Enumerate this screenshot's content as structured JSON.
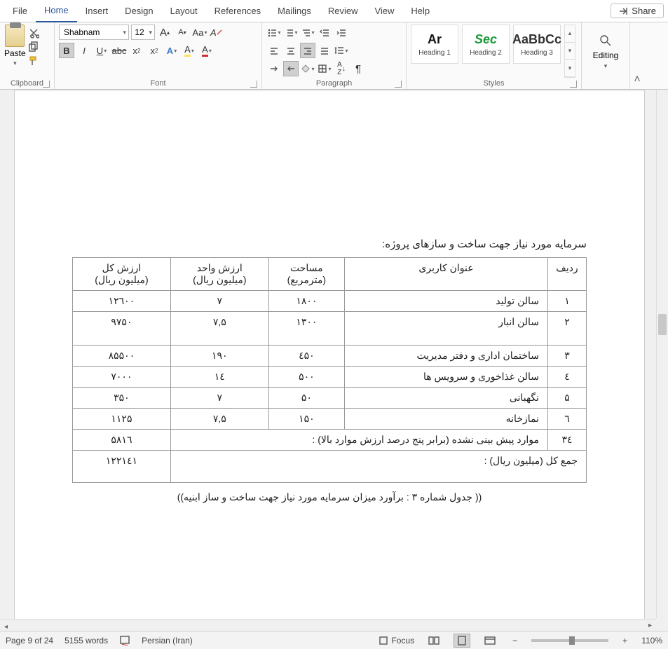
{
  "tabs": {
    "file": "File",
    "home": "Home",
    "insert": "Insert",
    "design": "Design",
    "layout": "Layout",
    "references": "References",
    "mailings": "Mailings",
    "review": "Review",
    "view": "View",
    "help": "Help",
    "share": "Share"
  },
  "ribbon": {
    "clipboard": {
      "label": "Clipboard",
      "paste": "Paste"
    },
    "font": {
      "label": "Font",
      "name": "Shabnam",
      "size": "12",
      "grow": "A",
      "shrink": "A",
      "case": "Aa",
      "bold": "B",
      "italic": "I",
      "underline": "U",
      "strike": "abc",
      "sub": "x",
      "sup": "x"
    },
    "paragraph": {
      "label": "Paragraph"
    },
    "styles": {
      "label": "Styles",
      "items": [
        {
          "preview": "Ar",
          "name": "Heading 1",
          "color": "#111",
          "weight": "800"
        },
        {
          "preview": "Sec",
          "name": "Heading 2",
          "color": "#1d9b3b",
          "weight": "800",
          "italic": true
        },
        {
          "preview": "AaBbCc",
          "name": "Heading 3",
          "color": "#333",
          "weight": "600"
        }
      ]
    },
    "editing": {
      "label": "Editing"
    }
  },
  "document": {
    "title": "سرمایه مورد نیاز جهت ساخت و سازهای پروژه:",
    "headers": {
      "row": "ردیف",
      "usage": "عنوان کاربری",
      "area": "مساحت",
      "area_unit": "(مترمربع)",
      "unit_val": "ارزش واحد",
      "unit_val_unit": "(میلیون ریال)",
      "total_val": "ارزش کل",
      "total_val_unit": "(میلیون ریال)"
    },
    "rows": [
      {
        "n": "۱",
        "usage": "سالن تولید",
        "area": "۱۸۰۰",
        "unit": "۷",
        "total": "۱۲٦۰۰"
      },
      {
        "n": "۲",
        "usage": "سالن انبار",
        "area": "۱۳۰۰",
        "unit": "۷,۵",
        "total": "۹۷۵۰"
      },
      {
        "n": "۳",
        "usage": "ساختمان اداری و دفتر مدیریت",
        "area": "٤۵۰",
        "unit": "۱۹۰",
        "total": "۸۵۵۰۰"
      },
      {
        "n": "٤",
        "usage": "سالن غذاخوری و سرویس ها",
        "area": "۵۰۰",
        "unit": "۱٤",
        "total": "۷۰۰۰"
      },
      {
        "n": "۵",
        "usage": "نگهبانی",
        "area": "۵۰",
        "unit": "۷",
        "total": "۳۵۰"
      },
      {
        "n": "٦",
        "usage": "نمازخانه",
        "area": "۱۵۰",
        "unit": "۷,۵",
        "total": "۱۱۲۵"
      }
    ],
    "contingency": {
      "n": "۳٤",
      "label": "موارد پیش بینی نشده (برابر پنج درصد ارزش موارد بالا) :",
      "total": "۵۸۱٦"
    },
    "grand": {
      "label": "جمع کل (میلیون ریال) :",
      "total": "۱۲۲۱٤۱"
    },
    "caption": "(( جدول شماره ۳ : برآورد میزان سرمایه مورد نیاز جهت ساخت و ساز ابنیه))"
  },
  "status": {
    "page": "Page 9 of 24",
    "words": "5155 words",
    "lang": "Persian (Iran)",
    "focus": "Focus",
    "zoom": "110%"
  }
}
